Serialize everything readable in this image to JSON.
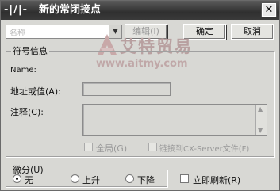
{
  "window": {
    "icon_text": "-|/|-",
    "title": "新的常闭接点",
    "close_glyph": "✕"
  },
  "toolbar": {
    "combo_value": "名称",
    "edit_label": "编辑(I)",
    "ok_label": "确定",
    "cancel_label": "取消"
  },
  "watermark": {
    "name": "艾特贸易",
    "url": "www.aitmy.com"
  },
  "symbol_info": {
    "legend": "符号信息",
    "name_label": "Name:",
    "address_label": "地址或值(A):",
    "comment_label": "注释(C):",
    "global_label": "全局(G)",
    "link_label": "链接到CX-Server文件(F)"
  },
  "differentiate": {
    "legend": "微分(U)",
    "options": [
      "无",
      "上升",
      "下降"
    ],
    "selected": "无",
    "refresh_label": "立即刷新(R)"
  }
}
